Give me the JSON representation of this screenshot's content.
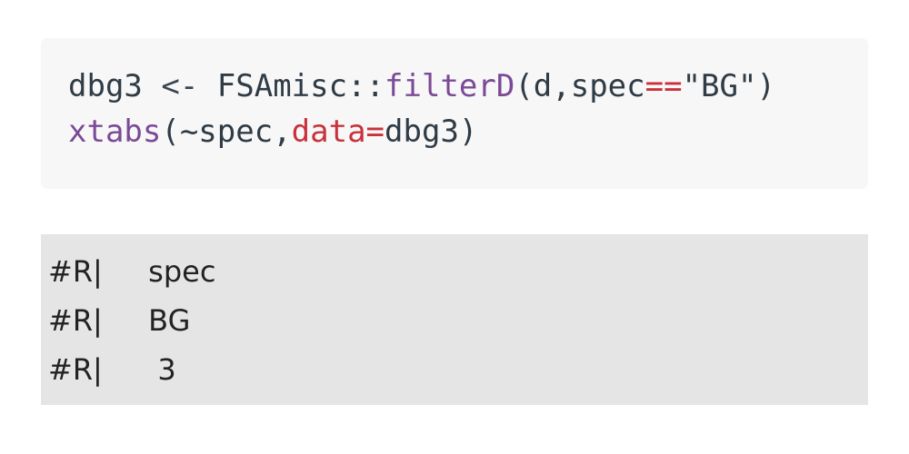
{
  "code": {
    "line1": {
      "var": "dbg3",
      "assign": " <- ",
      "pkg": "FSAmisc::",
      "fn": "filterD",
      "open": "(d,",
      "arg_name": "spec",
      "eq": "==",
      "str": "\"BG\"",
      "close": ")"
    },
    "line2": {
      "fn": "xtabs",
      "open": "(~spec,",
      "arg_name": "data",
      "eq": "=",
      "val": "dbg3",
      "close": ")"
    }
  },
  "output": {
    "prefix": "#R|",
    "lines": [
      " spec",
      " BG",
      "  3"
    ]
  },
  "colors": {
    "function": "#7b4a96",
    "argument": "#c8323a",
    "code_bg": "#f7f7f8",
    "output_bg": "#e5e5e5"
  }
}
